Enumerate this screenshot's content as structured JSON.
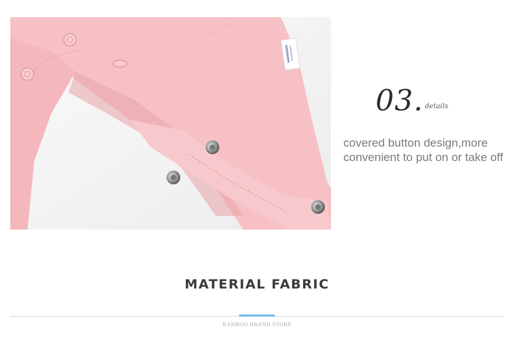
{
  "detail": {
    "number": "03.",
    "word": "details",
    "description": "covered button design,more convenient to put on or take off"
  },
  "section": {
    "title": "MATERIAL FABRIC"
  },
  "footer": {
    "store": "RANHOO BRAND STORE"
  },
  "colors": {
    "fabric": "#f7c3c6",
    "accent": "#6fb8e6"
  },
  "icons": [
    "snap-button-icon",
    "garment-tag-icon"
  ]
}
